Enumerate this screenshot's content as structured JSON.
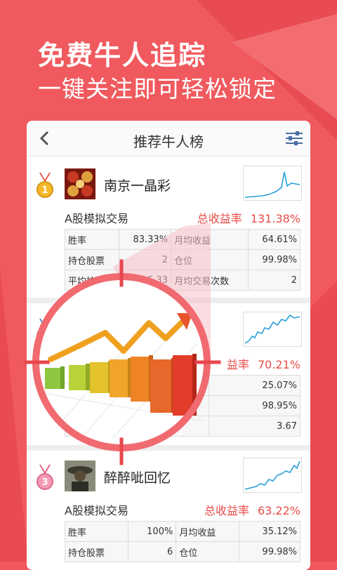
{
  "headline": "免费牛人追踪",
  "subheadline": "一键关注即可轻松锁定",
  "page_title": "推荐牛人榜",
  "colors": {
    "brand_red": "#f05a5e",
    "return_red": "#e74c47",
    "spark_blue": "#2a9fd8"
  },
  "entries": [
    {
      "rank": "1",
      "name": "南京一晶彩",
      "account": "A股模拟交易",
      "return_label": "总收益率",
      "return_value": "131.38%",
      "stats": [
        [
          "胜率",
          "83.33%",
          "月均收益",
          "64.61%"
        ],
        [
          "持仓股票",
          "2",
          "仓位",
          "99.98%"
        ],
        [
          "平均持股",
          "5.33",
          "月均交易次数",
          "2"
        ]
      ]
    },
    {
      "rank": "2",
      "name": "",
      "account": "",
      "return_label": "益率",
      "return_value": "70.21%",
      "stats": [
        [
          "",
          "",
          "",
          "25.07%"
        ],
        [
          "",
          "",
          "",
          "98.95%"
        ],
        [
          "",
          "",
          "均交易次数",
          "3.67"
        ]
      ]
    },
    {
      "rank": "3",
      "name": "醉醉呲回忆",
      "account": "A股模拟交易",
      "return_label": "总收益率",
      "return_value": "63.22%",
      "stats": [
        [
          "胜率",
          "100%",
          "月均收益",
          "35.12%"
        ],
        [
          "持仓股票",
          "6",
          "仓位",
          "99.98%"
        ]
      ]
    }
  ]
}
